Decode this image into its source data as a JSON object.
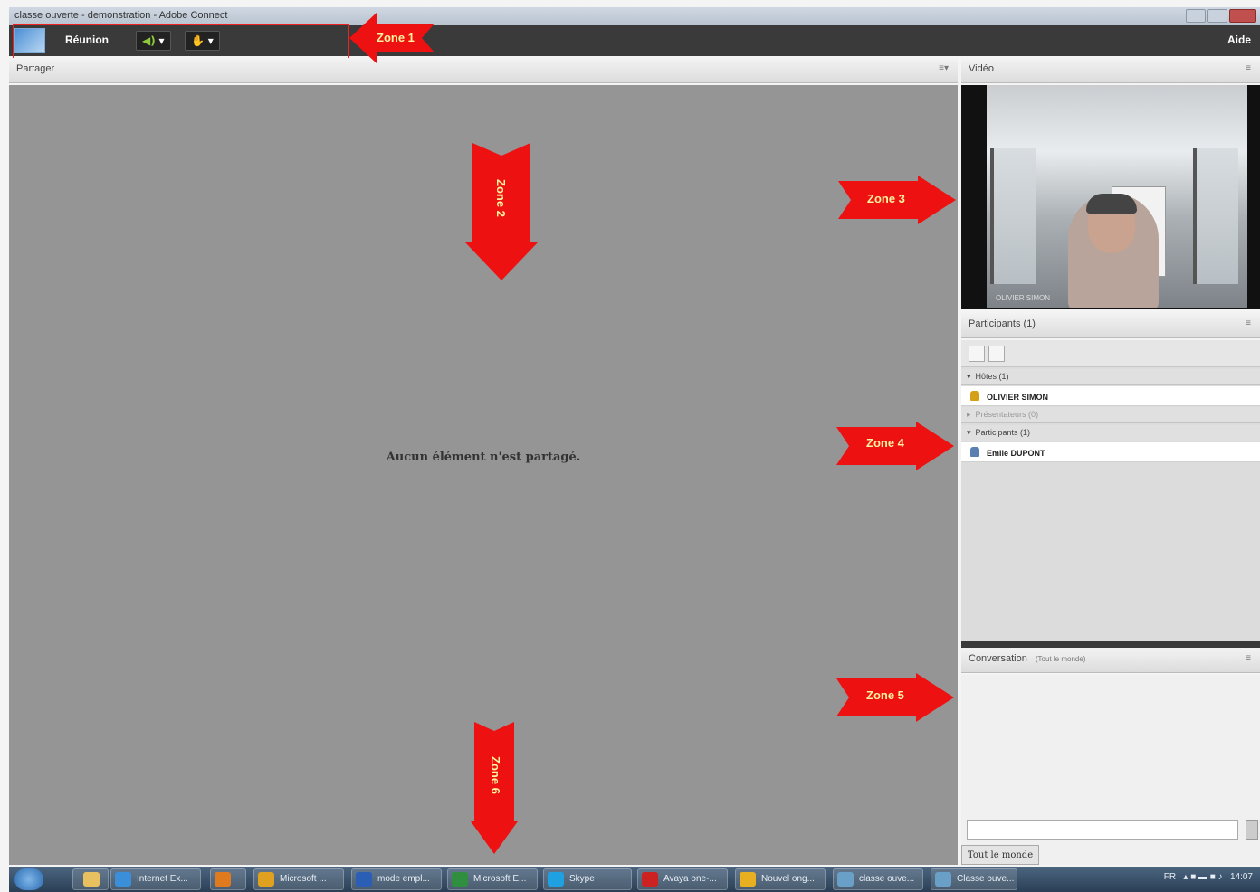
{
  "window": {
    "title": "classe ouverte - demonstration - Adobe Connect"
  },
  "menubar": {
    "meeting": "Réunion",
    "help": "Aide",
    "audio_icon": "speaker-icon",
    "audio_dropdown": "▾",
    "status_icon": "raise-hand-icon",
    "status_dropdown": "▾"
  },
  "share_pod": {
    "title": "Partager",
    "empty_message": "Aucun élément n'est partagé."
  },
  "video_pod": {
    "title": "Vidéo",
    "camera_label": "OLIVIER SIMON"
  },
  "participants_pod": {
    "title": "Participants (1)",
    "groups": [
      {
        "label": "Hôtes (1)",
        "users": [
          {
            "name": "OLIVIER SIMON",
            "role_color": "#d4a017"
          }
        ]
      },
      {
        "label": "Présentateurs (0)",
        "users": []
      },
      {
        "label": "Participants (1)",
        "users": [
          {
            "name": "Emile DUPONT",
            "role_color": "#5a7fb0"
          }
        ]
      }
    ]
  },
  "chat_pod": {
    "title": "Conversation",
    "scope": "(Tout le monde)",
    "tab_label": "Tout le monde"
  },
  "annotations": {
    "zone1": "Zone 1",
    "zone2": "Zone 2",
    "zone3": "Zone 3",
    "zone4": "Zone 4",
    "zone5": "Zone 5",
    "zone6": "Zone 6",
    "arrow_color": "#ee1111"
  },
  "taskbar": {
    "items": [
      {
        "label": "Internet Ex...",
        "color": "#3a8fd8"
      },
      {
        "label": "",
        "color": "#e07a1f"
      },
      {
        "label": "Microsoft ...",
        "color": "#e0a020"
      },
      {
        "label": "mode empl...",
        "color": "#2b5fb5"
      },
      {
        "label": "Microsoft E...",
        "color": "#2f8f3f"
      },
      {
        "label": "Skype",
        "color": "#1fa0e0"
      },
      {
        "label": "Avaya one-...",
        "color": "#cc2222"
      },
      {
        "label": "Nouvel ong...",
        "color": "#e8b020"
      },
      {
        "label": "classe ouve...",
        "color": "#6aa0c8"
      },
      {
        "label": "Classe ouve...",
        "color": "#6aa0c8"
      }
    ],
    "lang": "FR",
    "time": "14:07"
  }
}
